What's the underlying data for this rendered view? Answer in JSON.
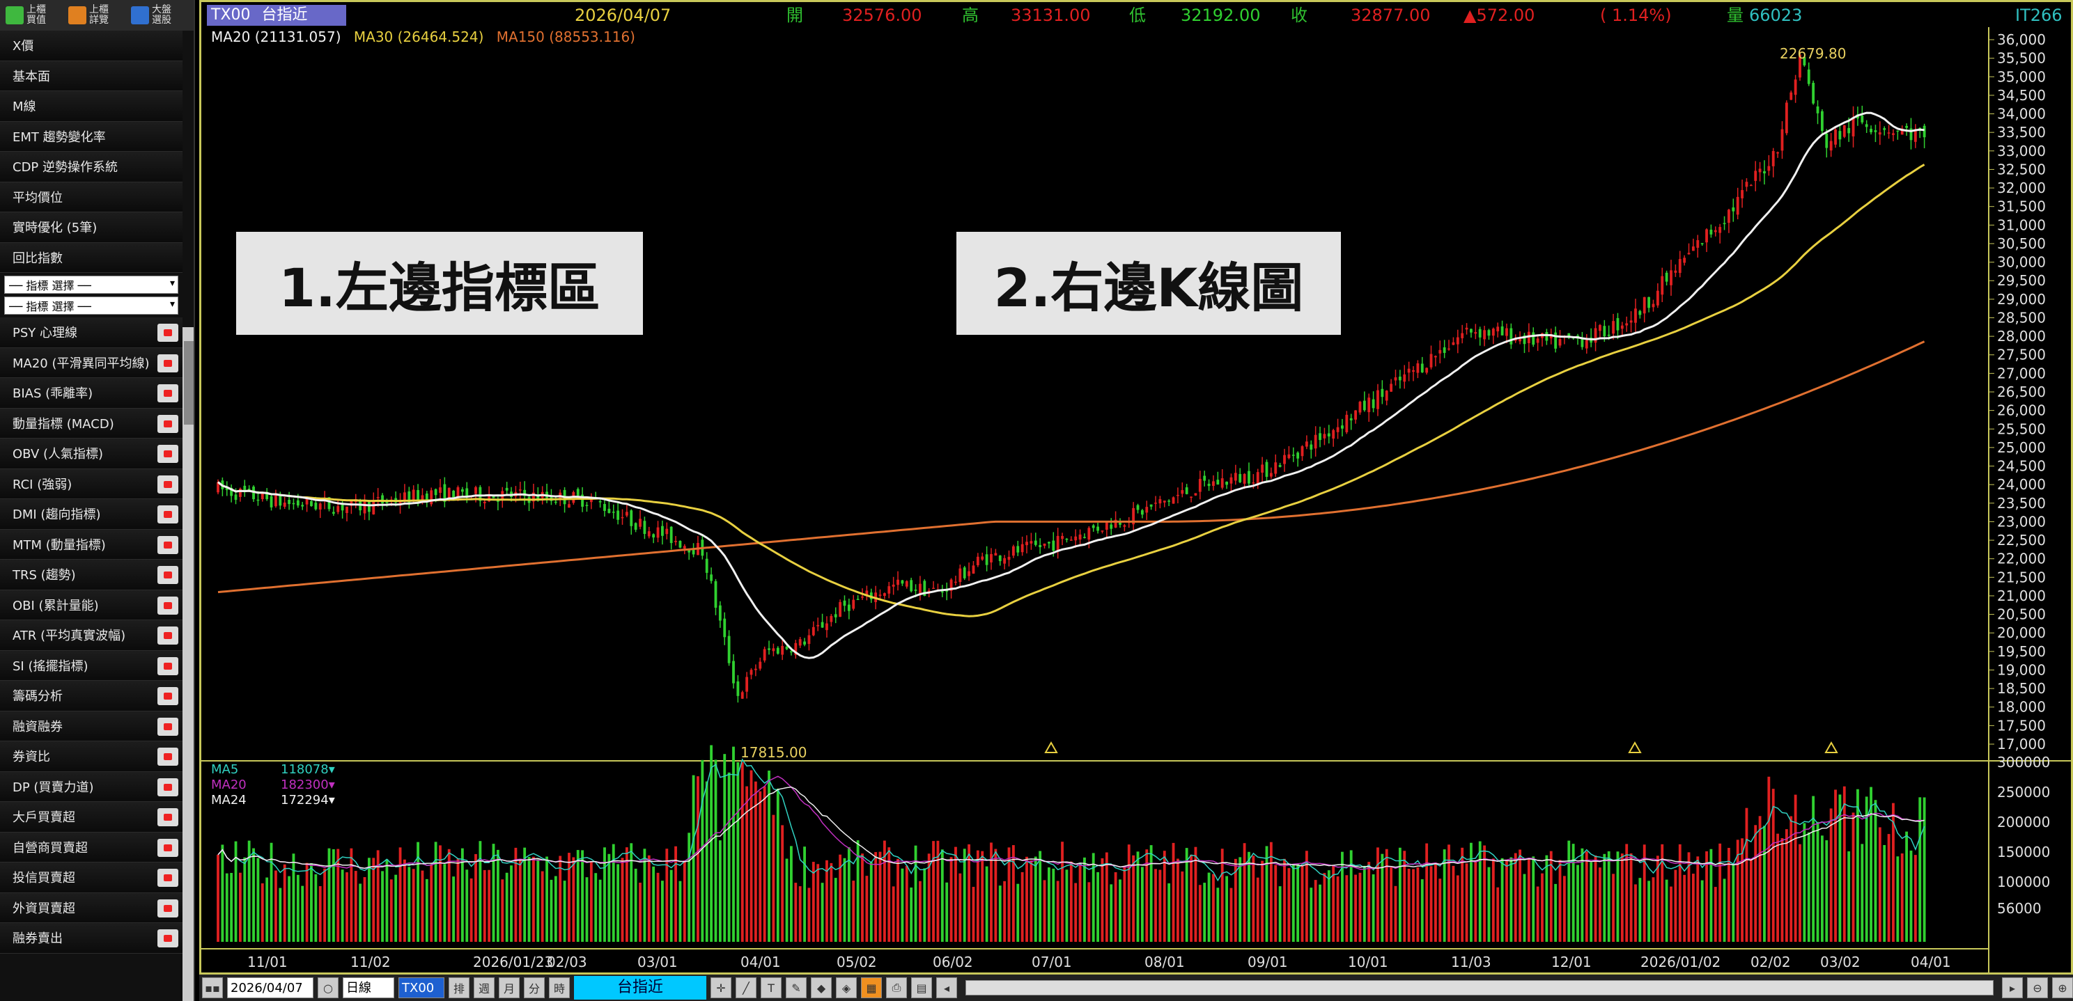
{
  "sidebar": {
    "top_buttons": [
      {
        "label": "上櫃 買值",
        "color": "#3fb83f"
      },
      {
        "label": "上櫃 詳覽",
        "color": "#e08020"
      },
      {
        "label": "大盤 選股",
        "color": "#3070d0"
      }
    ],
    "items_top": [
      "X價",
      "基本面",
      "M線",
      "EMT 趨勢變化率",
      "CDP 逆勢操作系統",
      "平均價位",
      "實時優化 (5筆)",
      "回比指數"
    ],
    "select1": "── 指標 選擇 ──",
    "select2": "── 指標 選擇 ──",
    "items": [
      "PSY 心理線",
      "MA20 (平滑異同平均線)",
      "BIAS (乖離率)",
      "動量指標 (MACD)",
      "OBV (人氣指標)",
      "RCI (強弱)",
      "DMI (趨向指標)",
      "MTM (動量指標)",
      "TRS (趨勢)",
      "OBI (累計量能)",
      "ATR (平均真實波幅)",
      "SI (搖擺指標)",
      "籌碼分析",
      "融資融券",
      "券資比",
      "DP (買賣力道)",
      "大戶買賣超",
      "自營商買賣超",
      "投信買賣超",
      "外資買賣超",
      "融券賣出"
    ]
  },
  "topbar": {
    "symbol": "TX00",
    "name": "台指近",
    "date": "2026/04/07",
    "open_label": "開",
    "open": "32576.00",
    "high_label": "高",
    "high": "33131.00",
    "low_label": "低",
    "low": "32192.00",
    "close_label": "收",
    "close": "32877.00",
    "change": "▲572.00",
    "change_pct": "( 1.14%)",
    "vol_label": "量",
    "volume": "66023",
    "right_code": "IT266"
  },
  "ma_legend": [
    {
      "label": "MA20 (21131.057)",
      "color": "#f0f0f0"
    },
    {
      "label": "MA30 (26464.524)",
      "color": "#e8d040"
    },
    {
      "label": "MA150 (88553.116)",
      "color": "#e07030"
    }
  ],
  "overlays": {
    "left": "1.左邊指標區",
    "right": "2.右邊K線圖"
  },
  "annotations": {
    "high": "22679.80",
    "low": "17815.00"
  },
  "vol_legend": [
    {
      "name": "MA5",
      "value": "118078▾",
      "color": "#30d0c0"
    },
    {
      "name": "MA20",
      "value": "182300▾",
      "color": "#c030c0"
    },
    {
      "name": "MA24",
      "value": "172294▾",
      "color": "#f0f0f0"
    }
  ],
  "price_axis": [
    "36,000",
    "35,500",
    "35,000",
    "34,500",
    "34,000",
    "33,500",
    "33,000",
    "32,500",
    "32,000",
    "31,500",
    "31,000",
    "30,500",
    "30,000",
    "29,500",
    "29,000",
    "28,500",
    "28,000",
    "27,500",
    "27,000",
    "26,500",
    "26,000",
    "25,500",
    "25,000",
    "24,500",
    "24,000",
    "23,500",
    "23,000",
    "22,500",
    "22,000",
    "21,500",
    "21,000",
    "20,500",
    "20,000",
    "19,500",
    "19,000",
    "18,500",
    "18,000",
    "17,500",
    "17,000"
  ],
  "vol_axis": [
    "300000",
    "250000",
    "200000",
    "150000",
    "100000",
    "56000"
  ],
  "date_axis": [
    "11/01",
    "11/02",
    "2026/01/23",
    "02/03",
    "03/01",
    "04/01",
    "05/02",
    "06/02",
    "07/01",
    "08/01",
    "09/01",
    "10/01",
    "11/03",
    "12/01",
    "2026/01/02",
    "02/02",
    "03/02",
    "04/01"
  ],
  "bottom": {
    "date": "2026/04/07",
    "mode": "日線",
    "symbol": "TX00",
    "name": "台指近",
    "tool_icons": [
      "排",
      "週",
      "月",
      "分",
      "時"
    ]
  },
  "colors": {
    "up": "#e02020",
    "down": "#30d030",
    "frame": "#c8c85a"
  }
}
